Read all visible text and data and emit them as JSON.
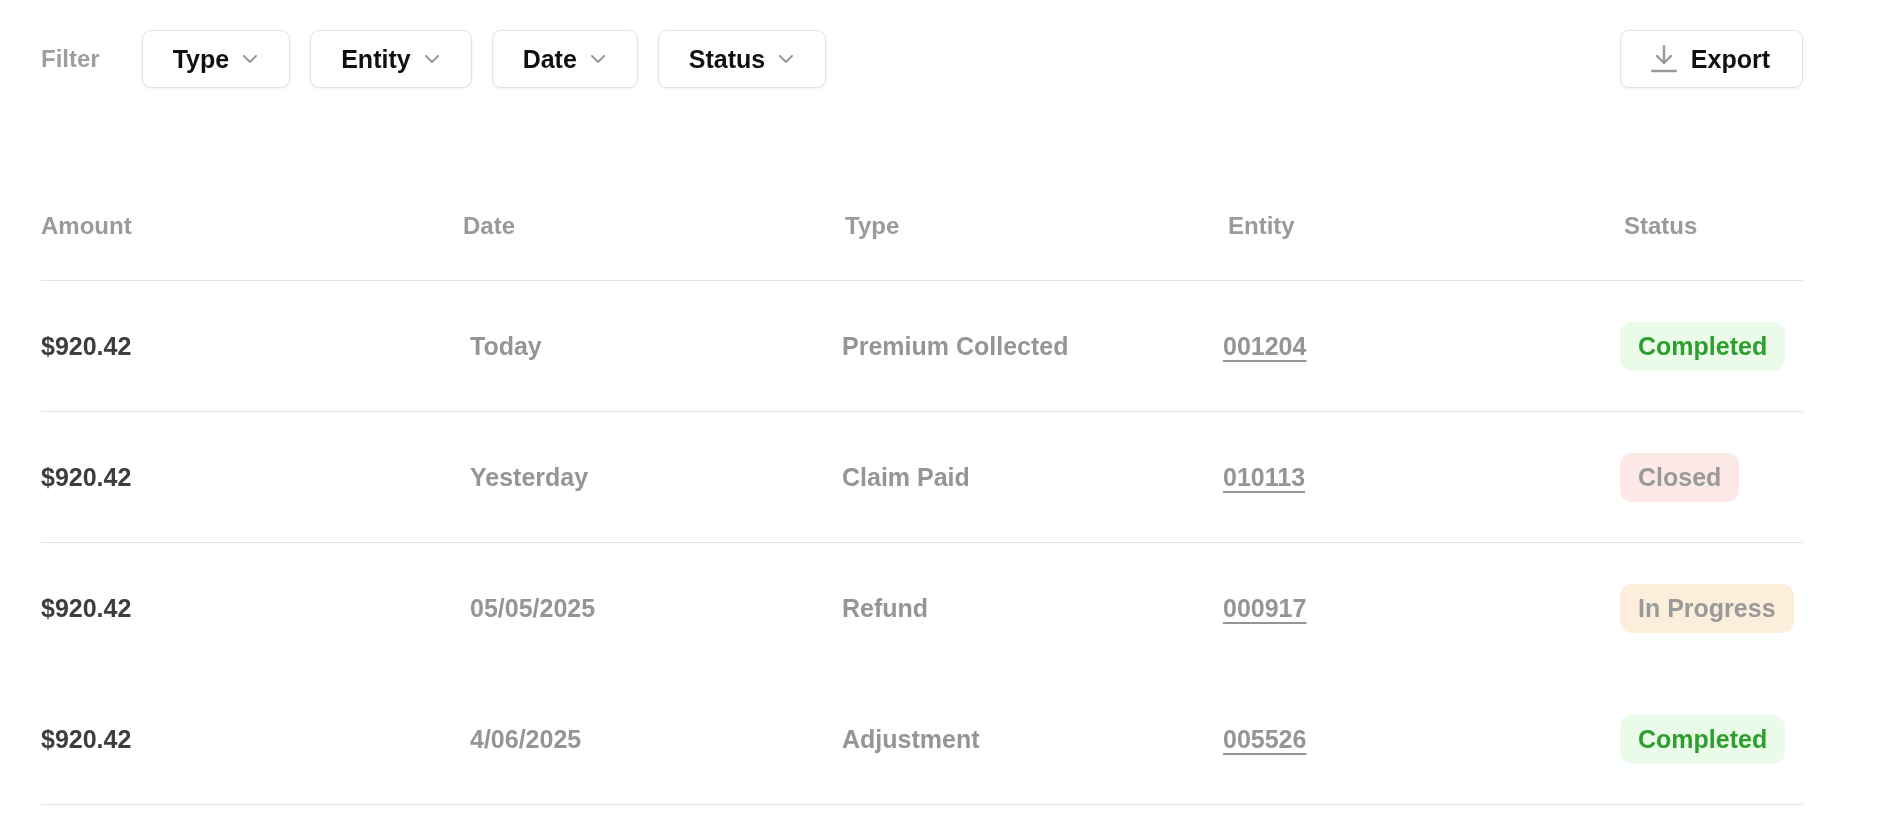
{
  "toolbar": {
    "filter_label": "Filter",
    "filters": [
      {
        "label": "Type"
      },
      {
        "label": "Entity"
      },
      {
        "label": "Date"
      },
      {
        "label": "Status"
      }
    ],
    "export_button": {
      "label": "Export"
    }
  },
  "table": {
    "columns": [
      "Amount",
      "Date",
      "Type",
      "Entity",
      "Status"
    ],
    "rows": [
      {
        "amount": "$920.42",
        "date": "Today",
        "type": "Premium Collected",
        "entity": "001204",
        "status": {
          "label": "Completed",
          "kind": "completed"
        },
        "separator": true
      },
      {
        "amount": "$920.42",
        "date": "Yesterday",
        "type": "Claim Paid",
        "entity": "010113",
        "status": {
          "label": "Closed",
          "kind": "closed"
        },
        "separator": true
      },
      {
        "amount": "$920.42",
        "date": "05/05/2025",
        "type": "Refund",
        "entity": "000917",
        "status": {
          "label": "In Progress",
          "kind": "progress"
        },
        "separator": false
      },
      {
        "amount": "$920.42",
        "date": "4/06/2025",
        "type": "Adjustment",
        "entity": "005526",
        "status": {
          "label": "Completed",
          "kind": "completed"
        },
        "separator": true
      }
    ]
  }
}
